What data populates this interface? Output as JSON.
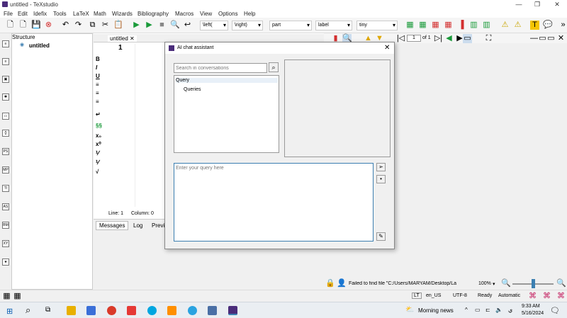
{
  "window": {
    "title": "untitled - TeXstudio"
  },
  "menu": [
    "File",
    "Edit",
    "Idefix",
    "Tools",
    "LaTeX",
    "Math",
    "Wizards",
    "Bibliography",
    "Macros",
    "View",
    "Options",
    "Help"
  ],
  "toolbar": {
    "left_combo": "\\left(",
    "right_combo": "\\right)",
    "part_combo": "part",
    "label_combo": "label",
    "size_combo": "tiny"
  },
  "structure": {
    "header": "Structure",
    "root": "untitled"
  },
  "editor": {
    "tab": "untitled",
    "line_number": "1",
    "cursor": "Line: 1",
    "column": "Column: 0",
    "bottom_tabs": [
      "Messages",
      "Log",
      "Previ"
    ]
  },
  "dialog": {
    "title": "AI chat assistant",
    "search_placeholder": "Search in conversations",
    "tree_items": [
      "Query",
      "Queries"
    ],
    "query_placeholder": "Enter your query here"
  },
  "pdf": {
    "page_value": "1",
    "page_total": "of 1",
    "error": "Failed to find file \"C:/Users/MARYAM/Desktop/La",
    "zoom": "100%"
  },
  "status": {
    "lt": "LT",
    "lang": "en_US",
    "encoding": "UTF-8",
    "ready": "Ready",
    "mode": "Automatic"
  },
  "taskbar": {
    "weather": "Morning news",
    "time": "9:33 AM",
    "date": "5/16/2024"
  },
  "colors": {
    "accent": "#3c7fb1",
    "run": "#1a9a3a",
    "stop": "#d32f2f",
    "taskbar_bg": "#eaeef2"
  }
}
